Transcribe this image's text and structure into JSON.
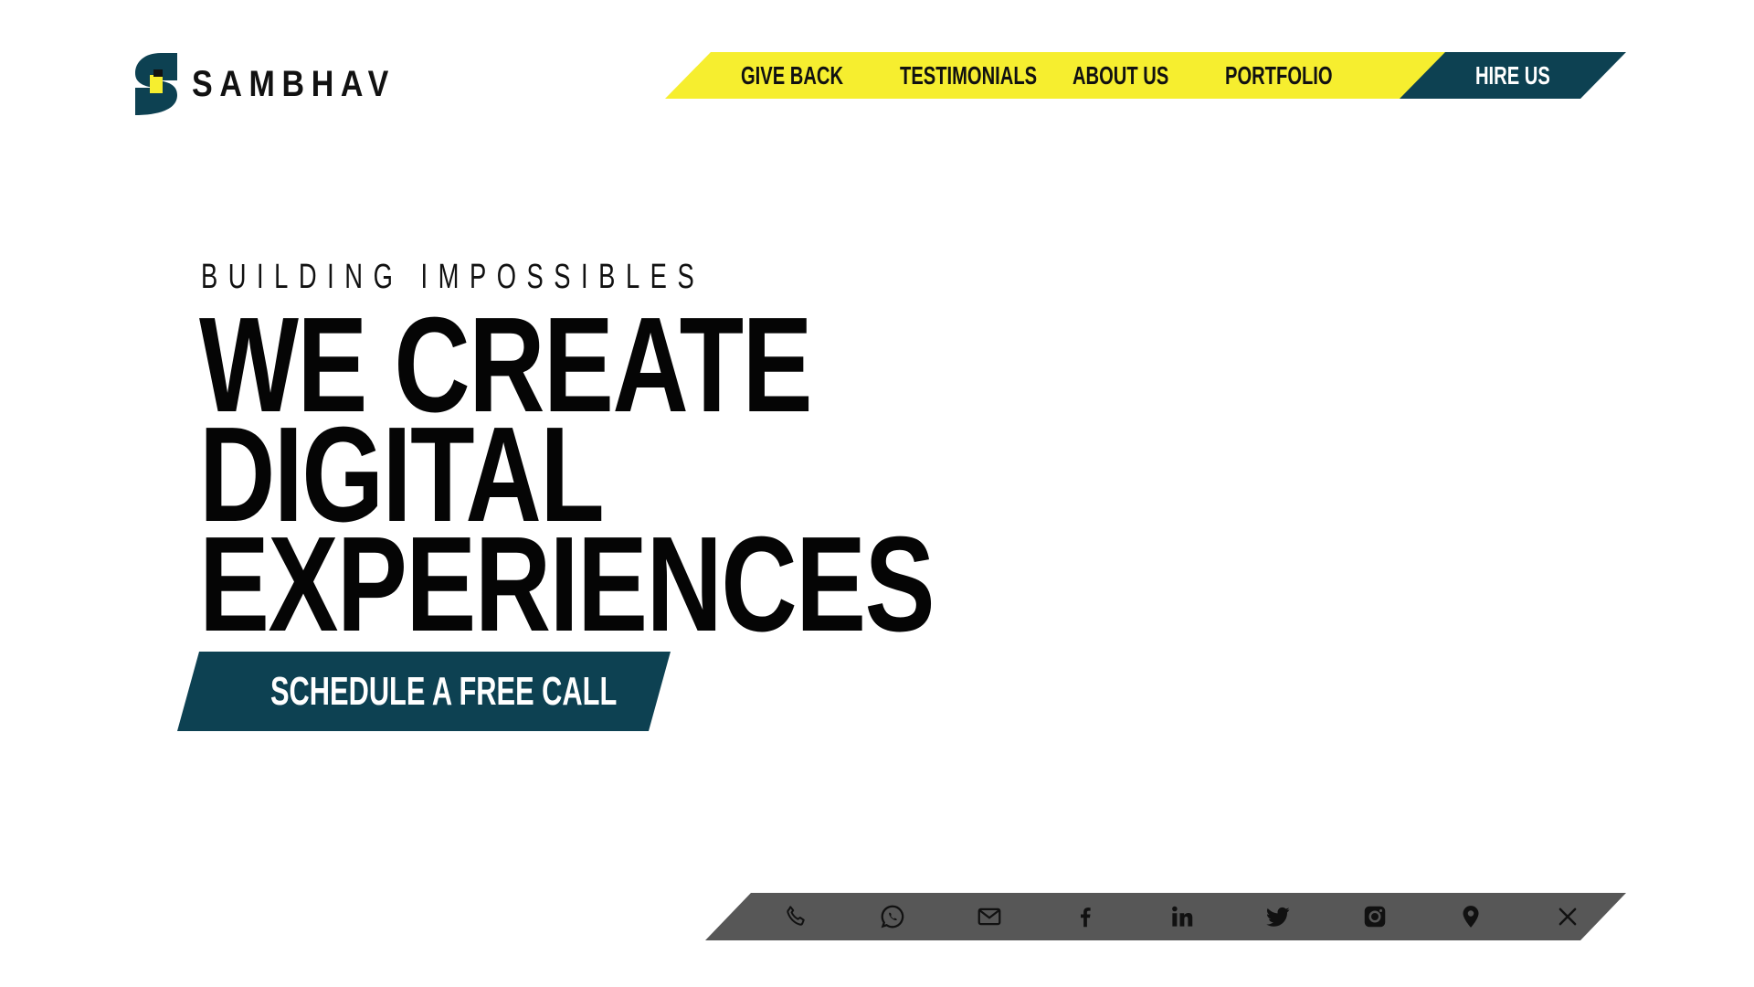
{
  "brand": {
    "name": "SAMBHAV",
    "logo_icon": "sambhav-s-logo-icon",
    "colors": {
      "dark_teal": "#0d4152",
      "yellow": "#f6ee2f",
      "gray": "#575757"
    }
  },
  "nav": {
    "items": [
      {
        "label": "GIVE BACK"
      },
      {
        "label": "TESTIMONIALS"
      },
      {
        "label": "ABOUT US"
      },
      {
        "label": "PORTFOLIO"
      }
    ],
    "hire_label": "HIRE US"
  },
  "hero": {
    "tagline": "BUILDING  IMPOSSIBLES",
    "headline_lines": [
      "WE CREATE",
      "DIGITAL",
      "EXPERIENCES"
    ],
    "cta_label": "SCHEDULE A FREE CALL"
  },
  "social": {
    "icons": [
      "phone-icon",
      "whatsapp-icon",
      "email-icon",
      "facebook-icon",
      "linkedin-icon",
      "twitter-icon",
      "instagram-icon",
      "location-icon",
      "close-icon"
    ]
  }
}
